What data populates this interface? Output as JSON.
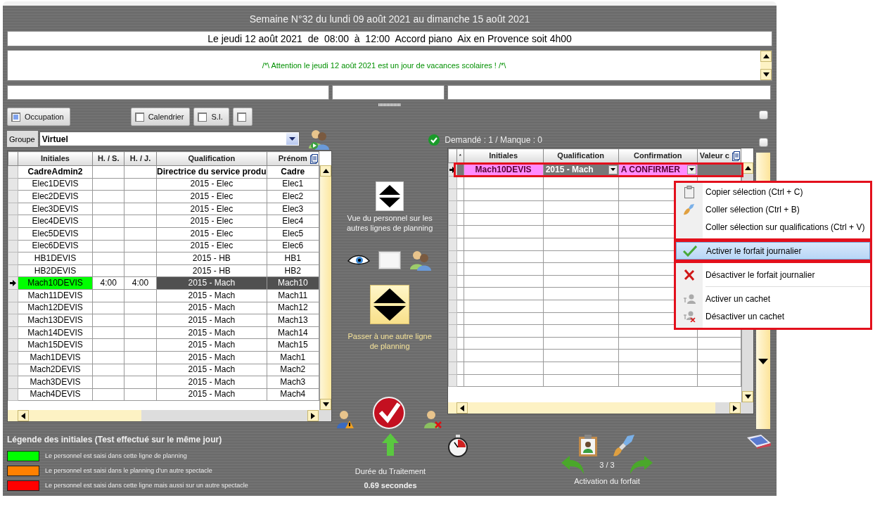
{
  "header": {
    "title": "Semaine N°32 du lundi 09 août 2021 au dimanche 15 août 2021",
    "info": "Le jeudi 12 août 2021  de  08:00  à  12:00  Accord piano  Aix en Provence soit 4h00",
    "warning": "/*\\ Attention le jeudi 12 août 2021 est un jour de vacances scolaires ! /*\\"
  },
  "toggles": [
    {
      "label": "Occupation",
      "checked": true
    },
    {
      "label": "Calendrier",
      "checked": false
    },
    {
      "label": "S.I.",
      "checked": false
    },
    {
      "checked": false
    }
  ],
  "side_checkboxes": [
    {
      "checked": false
    },
    {
      "checked": false
    }
  ],
  "group": {
    "label": "Groupe",
    "value": "Virtuel"
  },
  "staff_table": {
    "columns": [
      "Initiales",
      "H. / S.",
      "H. / J.",
      "Qualification",
      "Prénom"
    ],
    "rows": [
      {
        "cells": [
          "CadreAdmin2",
          "",
          "",
          "Directrice du service produ",
          "Cadre"
        ],
        "bold": true,
        "selected": false
      },
      {
        "cells": [
          "Elec1DEVIS",
          "",
          "",
          "2015 - Elec",
          "Elec1"
        ],
        "bold": false,
        "selected": false
      },
      {
        "cells": [
          "Elec2DEVIS",
          "",
          "",
          "2015 - Elec",
          "Elec2"
        ],
        "bold": false,
        "selected": false
      },
      {
        "cells": [
          "Elec3DEVIS",
          "",
          "",
          "2015 - Elec",
          "Elec3"
        ],
        "bold": false,
        "selected": false
      },
      {
        "cells": [
          "Elec4DEVIS",
          "",
          "",
          "2015 - Elec",
          "Elec4"
        ],
        "bold": false,
        "selected": false
      },
      {
        "cells": [
          "Elec5DEVIS",
          "",
          "",
          "2015 - Elec",
          "Elec5"
        ],
        "bold": false,
        "selected": false
      },
      {
        "cells": [
          "Elec6DEVIS",
          "",
          "",
          "2015 - Elec",
          "Elec6"
        ],
        "bold": false,
        "selected": false
      },
      {
        "cells": [
          "HB1DEVIS",
          "",
          "",
          "2015 - HB",
          "HB1"
        ],
        "bold": false,
        "selected": false
      },
      {
        "cells": [
          "HB2DEVIS",
          "",
          "",
          "2015 - HB",
          "HB2"
        ],
        "bold": false,
        "selected": false
      },
      {
        "cells": [
          "Mach10DEVIS",
          "4:00",
          "4:00",
          "2015 - Mach",
          "Mach10"
        ],
        "bold": false,
        "selected": true,
        "color": "#00ff00"
      },
      {
        "cells": [
          "Mach11DEVIS",
          "",
          "",
          "2015 - Mach",
          "Mach11"
        ],
        "bold": false,
        "selected": false
      },
      {
        "cells": [
          "Mach12DEVIS",
          "",
          "",
          "2015 - Mach",
          "Mach12"
        ],
        "bold": false,
        "selected": false
      },
      {
        "cells": [
          "Mach13DEVIS",
          "",
          "",
          "2015 - Mach",
          "Mach13"
        ],
        "bold": false,
        "selected": false
      },
      {
        "cells": [
          "Mach14DEVIS",
          "",
          "",
          "2015 - Mach",
          "Mach14"
        ],
        "bold": false,
        "selected": false
      },
      {
        "cells": [
          "Mach15DEVIS",
          "",
          "",
          "2015 - Mach",
          "Mach15"
        ],
        "bold": false,
        "selected": false
      },
      {
        "cells": [
          "Mach1DEVIS",
          "",
          "",
          "2015 - Mach",
          "Mach1"
        ],
        "bold": false,
        "selected": false
      },
      {
        "cells": [
          "Mach2DEVIS",
          "",
          "",
          "2015 - Mach",
          "Mach2"
        ],
        "bold": false,
        "selected": false
      },
      {
        "cells": [
          "Mach3DEVIS",
          "",
          "",
          "2015 - Mach",
          "Mach3"
        ],
        "bold": false,
        "selected": false
      },
      {
        "cells": [
          "Mach4DEVIS",
          "",
          "",
          "2015 - Mach",
          "Mach4"
        ],
        "bold": false,
        "selected": false
      }
    ]
  },
  "middle": {
    "view_caption": "Vue du personnel sur les autres lignes de planning",
    "switch_caption": "Passer à une autre ligne de planning"
  },
  "demand": "Demandé : 1 / Manque : 0",
  "assigned_table": {
    "columns": [
      "*",
      "Initiales",
      "Qualification",
      "Confirmation",
      "Valeur c"
    ],
    "rows": [
      {
        "initials": "Mach10DEVIS",
        "qualification": "2015 - Mach",
        "confirmation": "A CONFIRMER",
        "selected": true
      }
    ]
  },
  "context_menu": {
    "sections": [
      {
        "items": [
          {
            "kind": "clipboard",
            "label": "Copier sélection (Ctrl + C)",
            "selected": false
          },
          {
            "kind": "brush",
            "label": "Coller sélection (Ctrl + B)",
            "selected": false
          },
          {
            "kind": "none",
            "label": "Coller sélection sur qualifications (Ctrl + V)",
            "selected": false
          }
        ]
      },
      {
        "items": [
          {
            "kind": "check",
            "label": "Activer le forfait journalier",
            "selected": true
          }
        ]
      },
      {
        "items": [
          {
            "kind": "cross",
            "label": "Désactiver le forfait journalier",
            "selected": false
          },
          {
            "kind": "separator"
          },
          {
            "kind": "person",
            "label": "Activer un cachet",
            "selected": false
          },
          {
            "kind": "person-x",
            "label": "Désactiver un cachet",
            "selected": false
          }
        ]
      }
    ]
  },
  "legend": {
    "title": "Légende des initiales (Test effectué sur le même jour)",
    "items": [
      {
        "color": "#00ff00",
        "text": "Le personnel est saisi dans cette ligne de planning"
      },
      {
        "color": "#ff8000",
        "text": "Le personnel est saisi  dans le planning d'un autre spectacle"
      },
      {
        "color": "#ff0000",
        "text": "Le personnel est saisi dans cette ligne mais aussi sur un autre spectacle"
      }
    ]
  },
  "duration": {
    "label": "Durée du Traitement",
    "value": "0.69 secondes"
  },
  "pager": {
    "position": "3 / 3",
    "caption": "Activation du forfait"
  }
}
